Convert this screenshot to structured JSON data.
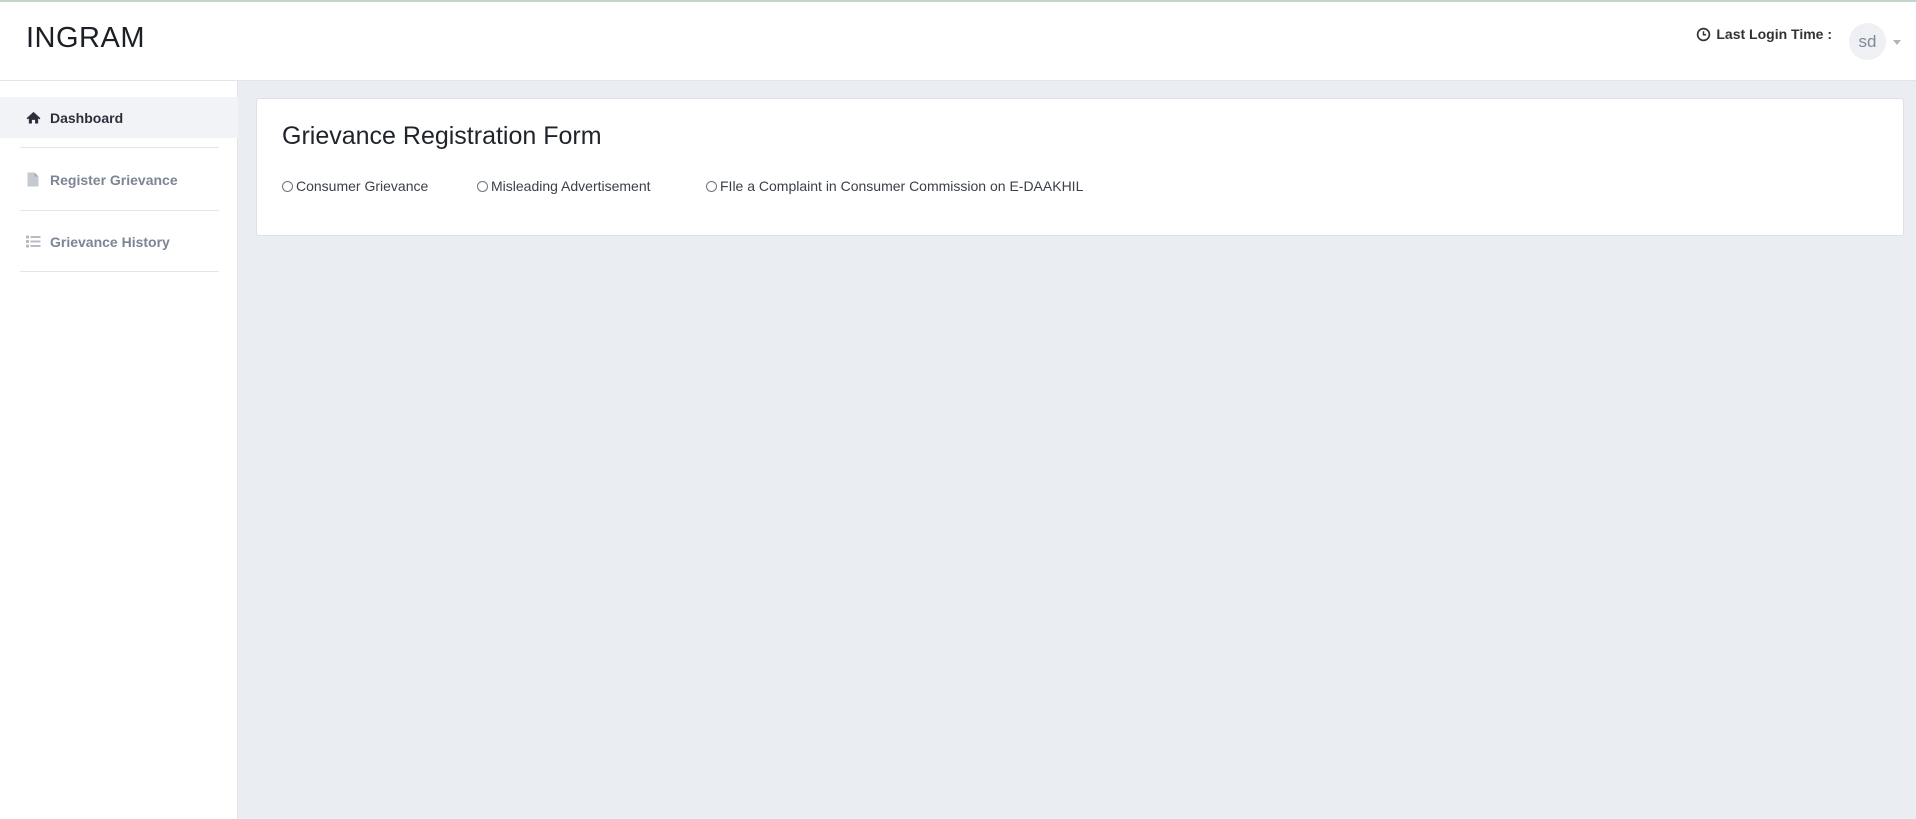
{
  "header": {
    "brand": "INGRAM",
    "last_login_label": "Last Login Time :",
    "avatar_initials": "sd"
  },
  "sidebar": {
    "items": [
      {
        "label": "Dashboard",
        "icon": "home-icon",
        "active": true
      },
      {
        "label": "Register Grievance",
        "icon": "document-icon",
        "active": false
      },
      {
        "label": "Grievance History",
        "icon": "list-icon",
        "active": false
      }
    ]
  },
  "main": {
    "form_title": "Grievance Registration Form",
    "options": [
      {
        "label": "Consumer Grievance",
        "selected": false
      },
      {
        "label": "Misleading Advertisement",
        "selected": false
      },
      {
        "label": "FIle a Complaint in Consumer Commission on E-DAAKHIL",
        "selected": false
      }
    ]
  },
  "colors": {
    "page_background": "#eaedf2",
    "active_nav_background": "#f1f3f6",
    "inactive_nav_text": "#7c8495"
  }
}
